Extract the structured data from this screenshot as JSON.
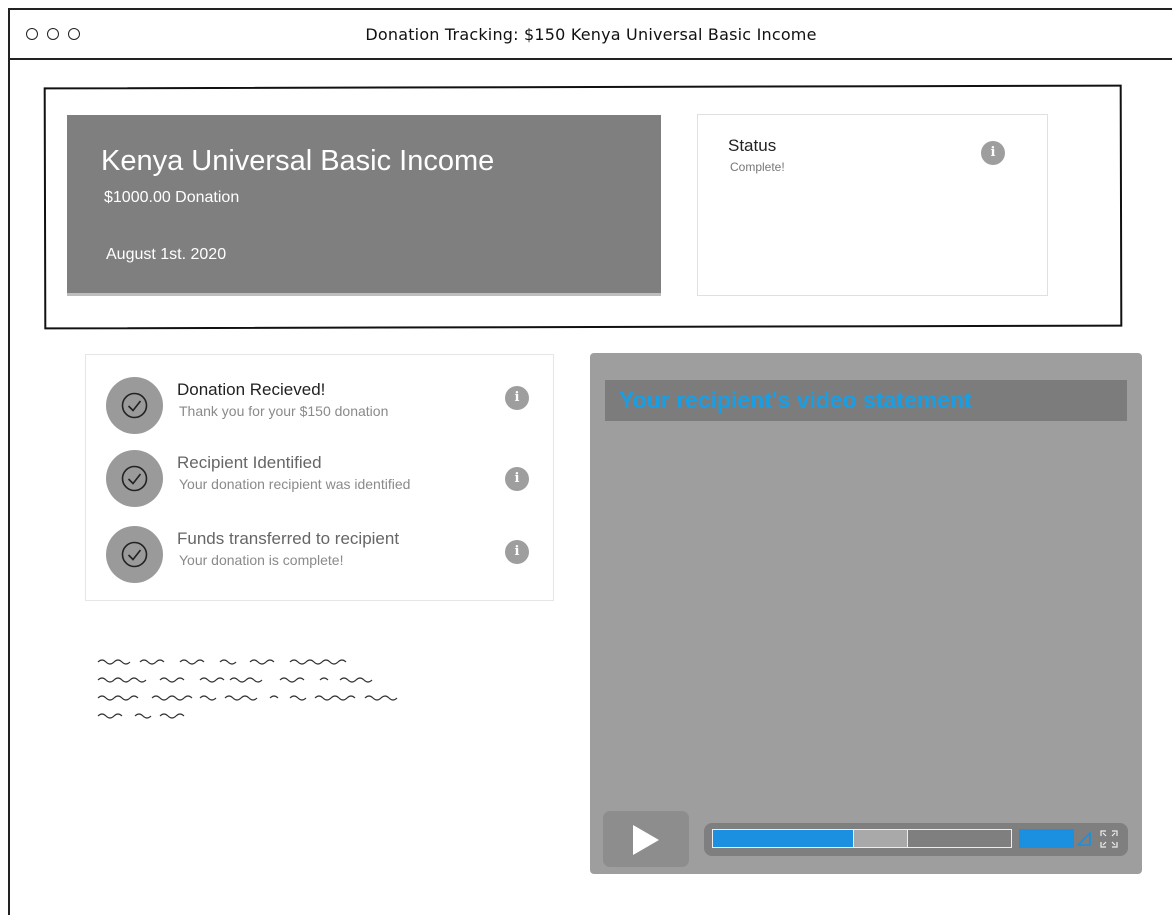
{
  "window": {
    "title": "Donation Tracking: $150 Kenya Universal Basic Income"
  },
  "hero": {
    "title": "Kenya Universal Basic Income",
    "amount": "$1000.00 Donation",
    "date": "August 1st. 2020"
  },
  "status": {
    "label": "Status",
    "value": "Complete!",
    "info_icon": "info-icon"
  },
  "steps": [
    {
      "title": "Donation Recieved!",
      "subtitle": "Thank you for your $150 donation",
      "icon": "check-circle-icon"
    },
    {
      "title": "Recipient Identified",
      "subtitle": "Your donation recipient was identified",
      "icon": "check-circle-icon"
    },
    {
      "title": "Funds transferred to recipient",
      "subtitle": "Your donation is complete!",
      "icon": "check-circle-icon"
    }
  ],
  "info_glyph": "i",
  "video": {
    "title": "Your recipient's video statement",
    "played_fraction": 0.47,
    "buffered_fraction": 0.65,
    "volume_level": 1.0,
    "accent_color": "#1b8fe0"
  }
}
